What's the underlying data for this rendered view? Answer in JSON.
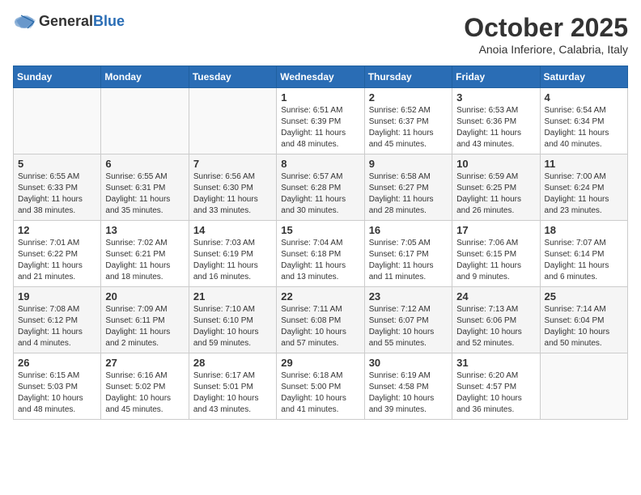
{
  "header": {
    "logo_general": "General",
    "logo_blue": "Blue",
    "month_title": "October 2025",
    "location": "Anoia Inferiore, Calabria, Italy"
  },
  "weekdays": [
    "Sunday",
    "Monday",
    "Tuesday",
    "Wednesday",
    "Thursday",
    "Friday",
    "Saturday"
  ],
  "weeks": [
    [
      {
        "day": "",
        "info": ""
      },
      {
        "day": "",
        "info": ""
      },
      {
        "day": "",
        "info": ""
      },
      {
        "day": "1",
        "info": "Sunrise: 6:51 AM\nSunset: 6:39 PM\nDaylight: 11 hours\nand 48 minutes."
      },
      {
        "day": "2",
        "info": "Sunrise: 6:52 AM\nSunset: 6:37 PM\nDaylight: 11 hours\nand 45 minutes."
      },
      {
        "day": "3",
        "info": "Sunrise: 6:53 AM\nSunset: 6:36 PM\nDaylight: 11 hours\nand 43 minutes."
      },
      {
        "day": "4",
        "info": "Sunrise: 6:54 AM\nSunset: 6:34 PM\nDaylight: 11 hours\nand 40 minutes."
      }
    ],
    [
      {
        "day": "5",
        "info": "Sunrise: 6:55 AM\nSunset: 6:33 PM\nDaylight: 11 hours\nand 38 minutes."
      },
      {
        "day": "6",
        "info": "Sunrise: 6:55 AM\nSunset: 6:31 PM\nDaylight: 11 hours\nand 35 minutes."
      },
      {
        "day": "7",
        "info": "Sunrise: 6:56 AM\nSunset: 6:30 PM\nDaylight: 11 hours\nand 33 minutes."
      },
      {
        "day": "8",
        "info": "Sunrise: 6:57 AM\nSunset: 6:28 PM\nDaylight: 11 hours\nand 30 minutes."
      },
      {
        "day": "9",
        "info": "Sunrise: 6:58 AM\nSunset: 6:27 PM\nDaylight: 11 hours\nand 28 minutes."
      },
      {
        "day": "10",
        "info": "Sunrise: 6:59 AM\nSunset: 6:25 PM\nDaylight: 11 hours\nand 26 minutes."
      },
      {
        "day": "11",
        "info": "Sunrise: 7:00 AM\nSunset: 6:24 PM\nDaylight: 11 hours\nand 23 minutes."
      }
    ],
    [
      {
        "day": "12",
        "info": "Sunrise: 7:01 AM\nSunset: 6:22 PM\nDaylight: 11 hours\nand 21 minutes."
      },
      {
        "day": "13",
        "info": "Sunrise: 7:02 AM\nSunset: 6:21 PM\nDaylight: 11 hours\nand 18 minutes."
      },
      {
        "day": "14",
        "info": "Sunrise: 7:03 AM\nSunset: 6:19 PM\nDaylight: 11 hours\nand 16 minutes."
      },
      {
        "day": "15",
        "info": "Sunrise: 7:04 AM\nSunset: 6:18 PM\nDaylight: 11 hours\nand 13 minutes."
      },
      {
        "day": "16",
        "info": "Sunrise: 7:05 AM\nSunset: 6:17 PM\nDaylight: 11 hours\nand 11 minutes."
      },
      {
        "day": "17",
        "info": "Sunrise: 7:06 AM\nSunset: 6:15 PM\nDaylight: 11 hours\nand 9 minutes."
      },
      {
        "day": "18",
        "info": "Sunrise: 7:07 AM\nSunset: 6:14 PM\nDaylight: 11 hours\nand 6 minutes."
      }
    ],
    [
      {
        "day": "19",
        "info": "Sunrise: 7:08 AM\nSunset: 6:12 PM\nDaylight: 11 hours\nand 4 minutes."
      },
      {
        "day": "20",
        "info": "Sunrise: 7:09 AM\nSunset: 6:11 PM\nDaylight: 11 hours\nand 2 minutes."
      },
      {
        "day": "21",
        "info": "Sunrise: 7:10 AM\nSunset: 6:10 PM\nDaylight: 10 hours\nand 59 minutes."
      },
      {
        "day": "22",
        "info": "Sunrise: 7:11 AM\nSunset: 6:08 PM\nDaylight: 10 hours\nand 57 minutes."
      },
      {
        "day": "23",
        "info": "Sunrise: 7:12 AM\nSunset: 6:07 PM\nDaylight: 10 hours\nand 55 minutes."
      },
      {
        "day": "24",
        "info": "Sunrise: 7:13 AM\nSunset: 6:06 PM\nDaylight: 10 hours\nand 52 minutes."
      },
      {
        "day": "25",
        "info": "Sunrise: 7:14 AM\nSunset: 6:04 PM\nDaylight: 10 hours\nand 50 minutes."
      }
    ],
    [
      {
        "day": "26",
        "info": "Sunrise: 6:15 AM\nSunset: 5:03 PM\nDaylight: 10 hours\nand 48 minutes."
      },
      {
        "day": "27",
        "info": "Sunrise: 6:16 AM\nSunset: 5:02 PM\nDaylight: 10 hours\nand 45 minutes."
      },
      {
        "day": "28",
        "info": "Sunrise: 6:17 AM\nSunset: 5:01 PM\nDaylight: 10 hours\nand 43 minutes."
      },
      {
        "day": "29",
        "info": "Sunrise: 6:18 AM\nSunset: 5:00 PM\nDaylight: 10 hours\nand 41 minutes."
      },
      {
        "day": "30",
        "info": "Sunrise: 6:19 AM\nSunset: 4:58 PM\nDaylight: 10 hours\nand 39 minutes."
      },
      {
        "day": "31",
        "info": "Sunrise: 6:20 AM\nSunset: 4:57 PM\nDaylight: 10 hours\nand 36 minutes."
      },
      {
        "day": "",
        "info": ""
      }
    ]
  ]
}
